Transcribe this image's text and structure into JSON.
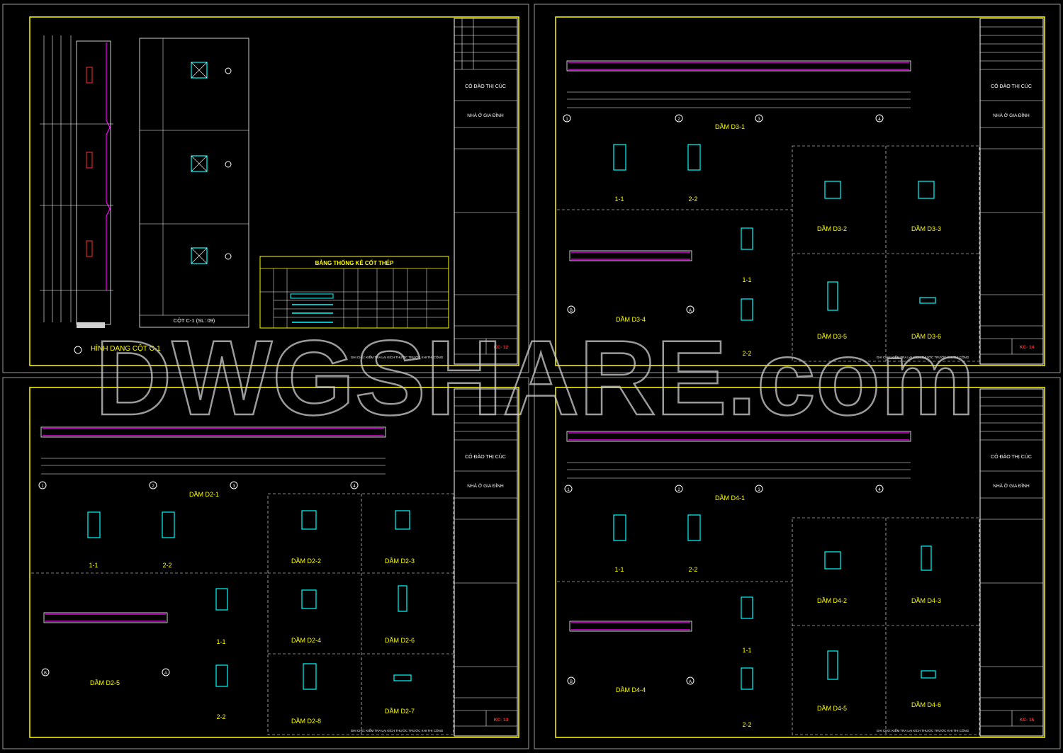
{
  "watermark": "DWGSHARE.com",
  "common": {
    "owner_title": "CÔ ĐÀO THỊ CÚC",
    "project_title": "NHÀ Ở GIA ĐÌNH",
    "note": "GHI CHÚ: KIỂM TRA LẠI KÍCH THƯỚC TRƯỚC KHI THI CÔNG"
  },
  "sheet1": {
    "column_shape_title": "HÌNH DẠNG CỘT C-1",
    "column_section_title": "CỘT C-1 (SL: 09)",
    "table_title": "BẢNG THỐNG KÊ CỐT THÉP",
    "sheet_code": "KC- 12"
  },
  "sheet2": {
    "beams": [
      "DẦM D3-1",
      "DẦM D3-2",
      "DẦM D3-3",
      "DẦM D3-4",
      "DẦM D3-5",
      "DẦM D3-6"
    ],
    "sections": [
      "1-1",
      "2-2",
      "1-1",
      "2-2"
    ],
    "axis_labels": [
      "1",
      "2",
      "3",
      "4",
      "B",
      "A"
    ],
    "sheet_code": "KC- 14"
  },
  "sheet3": {
    "beams": [
      "DẦM D2-1",
      "DẦM D2-2",
      "DẦM D2-3",
      "DẦM D2-4",
      "DẦM D2-5",
      "DẦM D2-6",
      "DẦM D2-7",
      "DẦM D2-8"
    ],
    "sections": [
      "1-1",
      "2-2",
      "1-1",
      "2-2"
    ],
    "axis_labels": [
      "1",
      "2",
      "3",
      "4",
      "B",
      "A"
    ],
    "sheet_code": "KC- 13"
  },
  "sheet4": {
    "beams": [
      "DẦM D4-1",
      "DẦM D4-2",
      "DẦM D4-3",
      "DẦM D4-4",
      "DẦM D4-5",
      "DẦM D4-6"
    ],
    "sections": [
      "1-1",
      "2-2",
      "1-1",
      "2-2"
    ],
    "axis_labels": [
      "1",
      "2",
      "3",
      "4",
      "B",
      "A"
    ],
    "sheet_code": "KC- 15"
  },
  "colors": {
    "frame": "#00e000",
    "yellow": "#ffff00",
    "cyan": "#00ffff",
    "magenta": "#ff00ff",
    "red": "#ff2020",
    "white": "#ffffff",
    "green": "#00ff00"
  }
}
